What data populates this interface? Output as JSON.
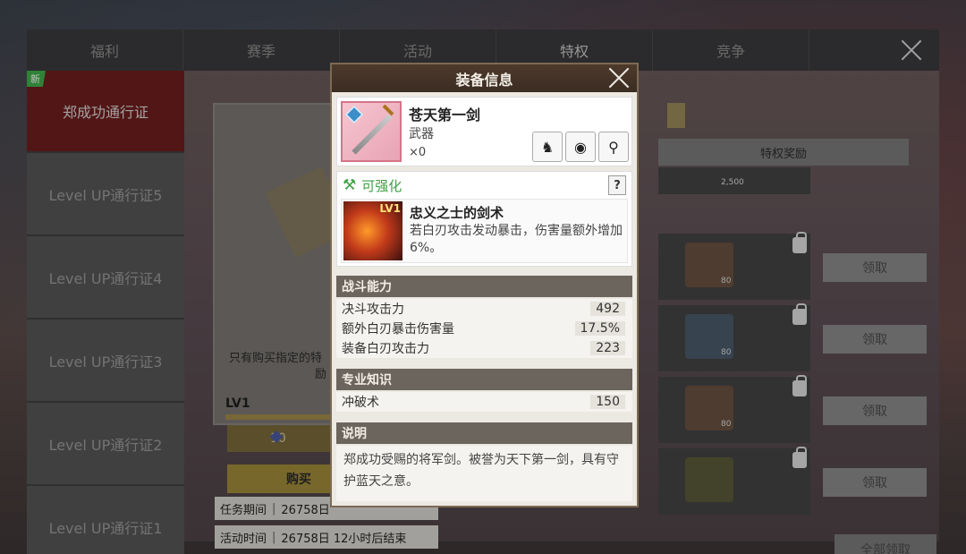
{
  "tabs": [
    "福利",
    "赛季",
    "活动",
    "特权",
    "竞争"
  ],
  "sidebar": {
    "new_badge": "新",
    "items": [
      {
        "label": "郑成功通行证",
        "active": true
      },
      {
        "label": "Level UP通行证5"
      },
      {
        "label": "Level UP通行证4"
      },
      {
        "label": "Level UP通行证3"
      },
      {
        "label": "Level UP通行证2"
      },
      {
        "label": "Level UP通行证1"
      }
    ]
  },
  "card": {
    "desc_line1": "只有购买指定的特",
    "desc_line2": "励",
    "level": "LV1",
    "price": "10",
    "buy_label": "购买"
  },
  "info": {
    "task_period_label": "任务期间",
    "task_period_value": "26758日",
    "activity_time_label": "活动时间",
    "activity_time_value": "26758日 12小时后结束"
  },
  "rewards": {
    "header": "特权奖励",
    "top_count": "2,500",
    "items": [
      {
        "count": "80",
        "claim": "领取"
      },
      {
        "count": "80",
        "claim": "领取"
      },
      {
        "count": "80",
        "claim": "领取"
      },
      {
        "count": "",
        "claim": "领取"
      }
    ],
    "claim_all": "全部领取"
  },
  "modal": {
    "title": "装备信息",
    "item": {
      "name": "苍天第一剑",
      "type": "武器",
      "count": "×0"
    },
    "enhance": {
      "label": "可强化",
      "help": "?",
      "skill": {
        "level": "LV1",
        "name": "忠义之士的剑术",
        "desc": "若白刃攻击发动暴击，伤害量额外增加6%。"
      }
    },
    "combat": {
      "title": "战斗能力",
      "stats": [
        {
          "label": "决斗攻击力",
          "value": "492"
        },
        {
          "label": "额外白刃暴击伤害量",
          "value": "17.5%"
        },
        {
          "label": "装备白刃攻击力",
          "value": "223"
        }
      ]
    },
    "expertise": {
      "title": "专业知识",
      "stats": [
        {
          "label": "冲破术",
          "value": "150"
        }
      ]
    },
    "description": {
      "title": "说明",
      "text": "郑成功受赐的将军剑。被誉为天下第一剑，具有守护蓝天之意。"
    }
  },
  "colors": {
    "modal_header": "#4d3a2c",
    "sidebar_active": "#6e1e1e",
    "enhance_green": "#3fa046",
    "section_header": "#6b655d"
  },
  "icons": [
    "close-icon",
    "gem-icon",
    "lock-icon",
    "wrench-icon",
    "equip-icon",
    "eye-icon",
    "location-icon",
    "help-icon"
  ]
}
